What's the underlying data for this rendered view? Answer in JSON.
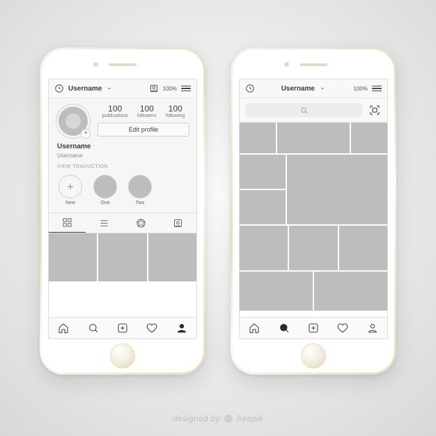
{
  "battery": "100%",
  "profile": {
    "topbar_title": "Username",
    "stats": [
      {
        "n": "100",
        "l": "publications"
      },
      {
        "n": "100",
        "l": "followers"
      },
      {
        "n": "100",
        "l": "following"
      }
    ],
    "edit_label": "Edit profile",
    "bio_name": "Username",
    "bio_sub": "Username",
    "view_translation": "VIEW TRADUCTION",
    "highlights": [
      {
        "label": "New"
      },
      {
        "label": "One"
      },
      {
        "label": "Two"
      }
    ]
  },
  "credit": "designed by",
  "credit_brand": "freepik"
}
